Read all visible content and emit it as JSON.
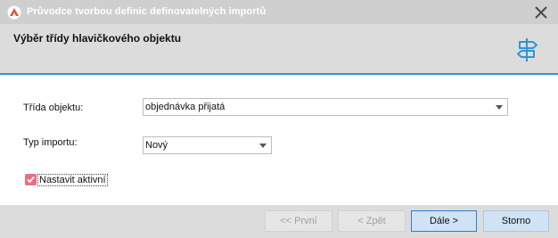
{
  "window": {
    "title": "Průvodce tvorbou definic definovatelných importů",
    "app_icon": "app-logo-icon",
    "close_icon": "close-icon"
  },
  "header": {
    "title": "Výběr třídy hlavičkového objektu",
    "icon": "signpost-icon"
  },
  "form": {
    "class_label": "Třída objektu:",
    "class_value": "objednávka přijatá",
    "type_label": "Typ importu:",
    "type_value": "Nový",
    "active_label": "Nastavit aktivní",
    "active_checked": true
  },
  "buttons": {
    "first": "<< První",
    "back": "< Zpět",
    "next": "Dále >",
    "cancel": "Storno"
  },
  "colors": {
    "accent": "#2f95d6",
    "checkbox": "#e8707f",
    "titlebar": "#cfcfcf",
    "header": "#dcdcdc"
  }
}
